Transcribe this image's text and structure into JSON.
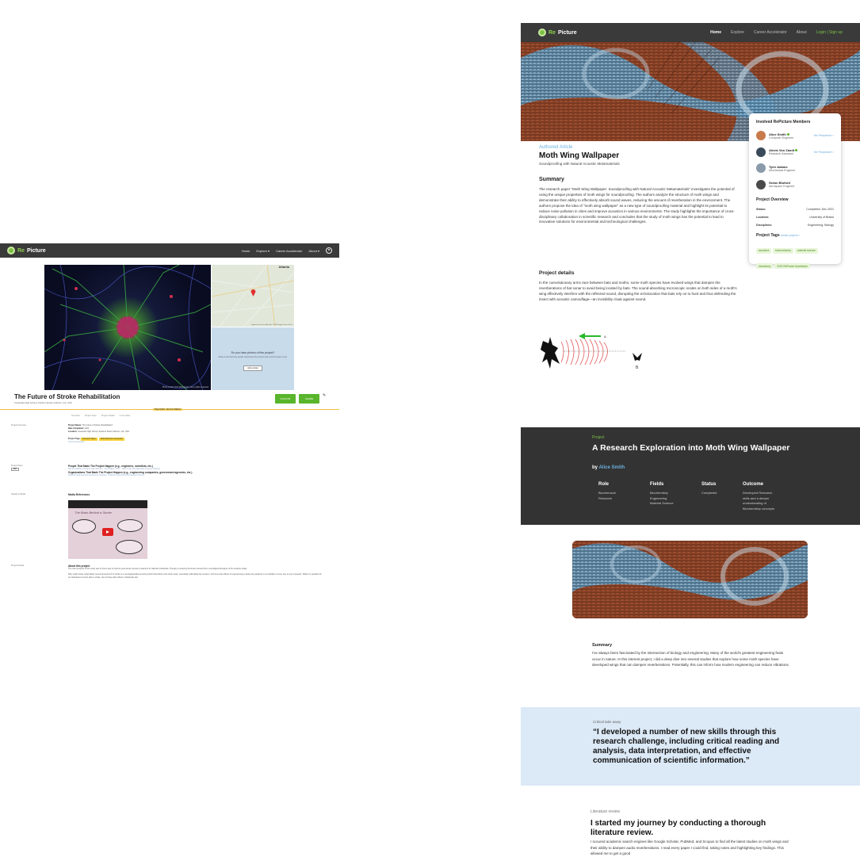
{
  "brand": {
    "re": "Re",
    "picture": "Picture"
  },
  "left": {
    "nav": {
      "home": "Home",
      "explore": "Explore ▾",
      "career": "Career Accelerator",
      "about": "About ▾"
    },
    "image_credit": "Photo credit: CCO Microscopy, some rights reserved",
    "map_city": "Atlanta",
    "map_attribution": "Keyboard shortcuts   Map data ©2023 Google   Terms of Use",
    "photo_prompt": {
      "question": "Do you have photos of this project?",
      "sub": "Share a few that help people understand the project work and its impact so far.",
      "button": "Add a photo"
    },
    "title": "The Future of Stroke Rehabilitation",
    "subtitle": "Creekside High School, Fairburn Road, Fairburn, GA, USA",
    "follow": "FOLLOW",
    "share": "SHARE",
    "page_editor": "Page Editor: Jasmine Wallace",
    "tabs": [
      "Overview",
      "Project Team",
      "Project Details",
      "In the News"
    ],
    "overview": {
      "label": "Project Overview",
      "name_label": "Project Name:",
      "name": "The Future of Stroke Rehabilitation",
      "date_label": "Date Completed:",
      "date": "2022",
      "loc_label": "Location:",
      "loc": "Creekside High School, Fairburn Road, Fairburn, GA, USA",
      "tags_label": "Project Tags:",
      "tags": [
        "Research Paper",
        "2023 RePicture Accelerator"
      ],
      "more": "Show all tag options"
    },
    "team": {
      "label": "Project Team",
      "edit": "Edit",
      "people_h": "People That Made The Project Happen (e.g., engineers, scientists, etc.)",
      "people": "Jasmine Wallace, Research Team Member  ·  Dee Wallace, Ph.D.  ·  Caleb Lewis (Georgia State University Student)",
      "orgs_h": "Organizations That Made The Project Happen (e.g., engineering companies, government agencies, etc.)",
      "orgs": "Fieldwork Engineering & Lab Science Company  ·  Fairfield Creek Park & Recreational Services"
    },
    "news": {
      "label": "Awards & Media",
      "media_h": "Media References",
      "video_title": "The Future of Stroke Rehabilitation - Jasmine Wallace",
      "video_banner": "The Brain Behind a Stroke"
    },
    "details": {
      "label": "Project Details",
      "about_h": "About this project",
      "p1": "The main purpose of this study was to find a way to improve post-stroke recovery treatment for affected individuals. Therapy is studying the fitness derived from neurological therapies of the students today.",
      "p2": "Why might stroke rehab affect need improvement? A stroke is a neurological illness during which blood flow to the brain stops, essentially suffocating the neurons. Common side effects of experiencing a stroke are paralysis or an inability to move one or any of speech. While it is possible for an individual to survive after a stroke, due to these after-effects, individuals who"
    }
  },
  "right_top": {
    "nav": {
      "home": "Home",
      "explore": "Explore",
      "career": "Career Accelerator",
      "about": "About",
      "login": "Login | Sign up"
    },
    "authored": "Authored Article",
    "title": "Moth Wing Wallpaper",
    "subtitle": "Soundproofing with Natural Acoustic Metamaterials",
    "summary_h": "Summary",
    "summary": "The research paper \"Moth Wing Wallpaper: Soundproofing with Natural Acoustic Metamaterials\" investigates the potential of using the unique properties of moth wings for soundproofing. The authors analyze the structure of moth wings and demonstrate their ability to effectively absorb sound waves, reducing the amount of reverberation in the environment. The authors propose the idea of \"moth wing wallpaper\" as a new type of soundproofing material and highlight its potential to reduce noise pollution in cities and improve acoustics in various environments. The study highlights the importance of cross-disciplinary collaboration in scientific research and concludes that the study of moth wings has the potential to lead to innovative solutions for environmental and technological challenges.",
    "details_h": "Project details",
    "details": "In the coevolutionary arms race between bats and moths, some moth species have evolved wings that dampen the reverberations of bat sonar to avoid being located by bats. The sound-absorbing microscopic scales on both sides of a moth's wing effectively interfere with the reflected sound, disrupting the echolocation that bats rely on to hunt and thus defending the insect with acoustic camouflage—an invisibility cloak against sound.",
    "sonar_labels": {
      "a": "A",
      "b": "B"
    },
    "members_h": "Involved RePicture Members",
    "members": [
      {
        "name": "Alice Smith",
        "role": "Computer Engineer",
        "verified": true,
        "perspective": "Her Perspective >",
        "color": "#c87a4a"
      },
      {
        "name": "Alexis Von Zandt",
        "role": "Research Assistant",
        "verified": true,
        "perspective": "Her Perspective >",
        "color": "#3a4a5a"
      },
      {
        "name": "Tyler Adams",
        "role": "Mechanical Engineer",
        "verified": false,
        "perspective": "",
        "color": "#8a9aaa"
      },
      {
        "name": "Gulon Bluford",
        "role": "Aerospace Engineer",
        "verified": false,
        "perspective": "",
        "color": "#4a4a4a"
      }
    ],
    "overview_h": "Project Overview",
    "overview": [
      {
        "k": "Status:",
        "v": "Completed, Dec 2021"
      },
      {
        "k": "Location:",
        "v": "University of Bristol"
      },
      {
        "k": "Disciplines:",
        "v": "Engineering, Biology"
      }
    ],
    "tags_h": "Project Tags",
    "tags_link": "similar projects >",
    "tags": [
      "acoustics",
      "biomechanics",
      "material science",
      "biomimicry",
      "2023 RePicture Accelerator"
    ]
  },
  "right_bottom": {
    "label": "Project",
    "title": "A Research Exploration into Moth Wing Wallpaper",
    "by": "by",
    "author": "Alice Smith",
    "columns": [
      {
        "h": "Role",
        "lines": [
          "Biochemical",
          "Research"
        ]
      },
      {
        "h": "Fields",
        "lines": [
          "Biochemistry",
          "Engineering",
          "Material Science"
        ]
      },
      {
        "h": "Status",
        "lines": [
          "Completed"
        ]
      },
      {
        "h": "Outcome",
        "lines": [
          "Developed Research",
          "skills and a deeper",
          "understanding of",
          "Biochemistry concepts"
        ]
      }
    ],
    "summary_h": "Summary",
    "summary": "I've always been fascinated by the intersection of biology and engineering. Many of the world's greatest engineering feats occur in nature. In this interest project, I did a deep dive into several studies that explore how some moth species have developed wings that can dampen reverberations. Potentially, this can inform how modern engineering can reduce vibrations.",
    "quote_label": "Critical take away",
    "quote": "“I developed a number of new skills through this research challenge, including critical reading and analysis, data interpretation, and effective communication of scientific information.”",
    "lit_label": "Literature review",
    "lit_h": "I started my journey by conducting a thorough literature review.",
    "lit_p": "I scoured academic search engines like Google Scholar, PubMed, and Scopus to find all the latest studies on moth wings and their ability to dampen audio reverberations. I read every paper I could find, taking notes and highlighting key findings. This allowed me to get a good"
  }
}
